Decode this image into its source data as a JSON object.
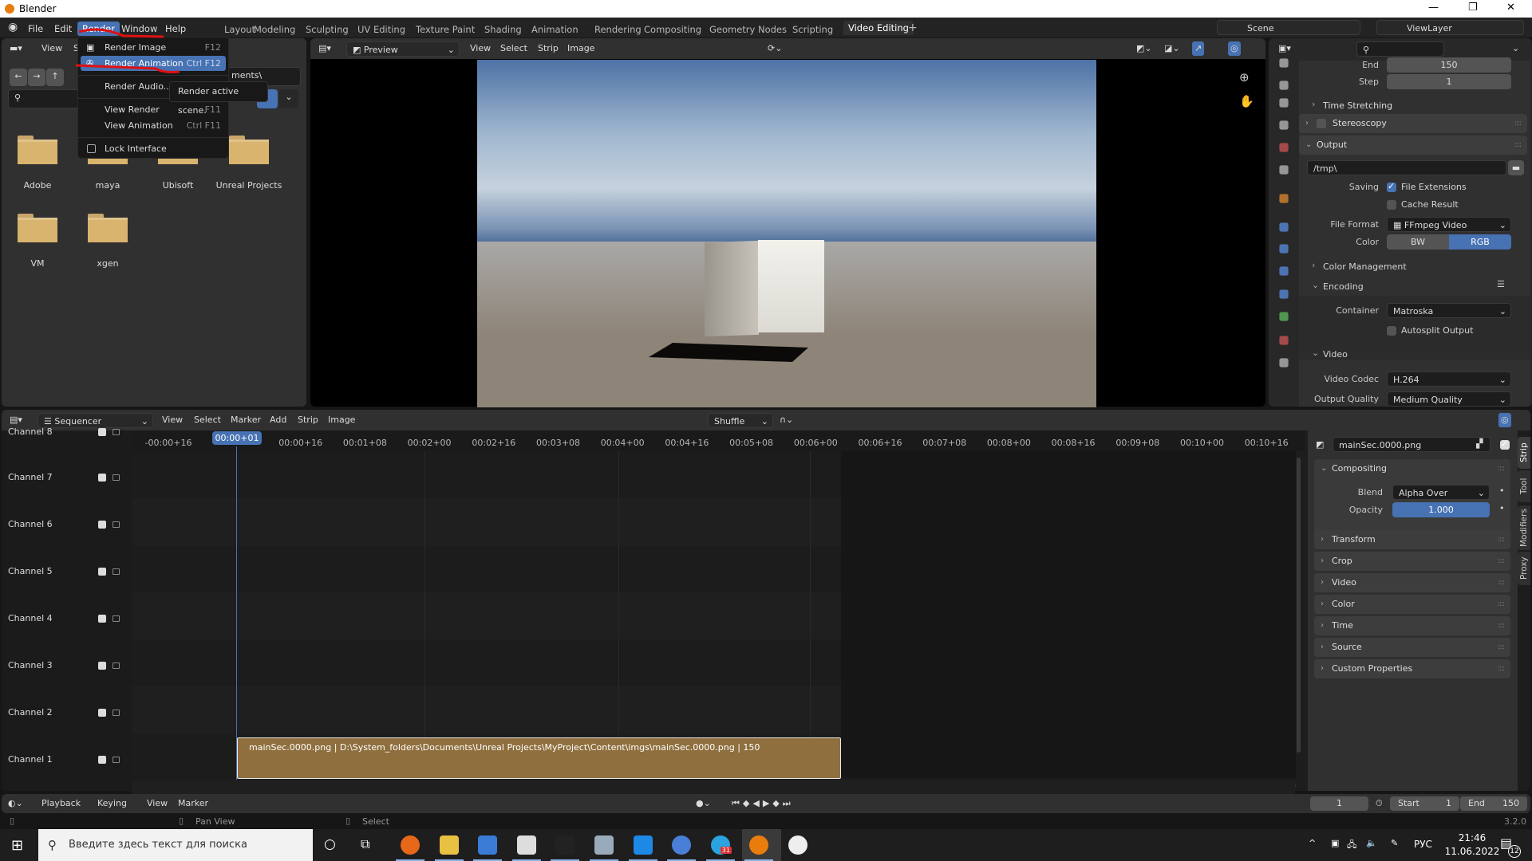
{
  "window": {
    "title": "Blender",
    "min": "—",
    "max": "❐",
    "close": "✕"
  },
  "menubar": {
    "items": [
      "File",
      "Edit",
      "Render",
      "Window",
      "Help"
    ],
    "active": "Render"
  },
  "workspaces": {
    "tabs": [
      "Layout",
      "Modeling",
      "Sculpting",
      "UV Editing",
      "Texture Paint",
      "Shading",
      "Animation",
      "Rendering",
      "Compositing",
      "Geometry Nodes",
      "Scripting",
      "Video Editing"
    ],
    "active": "Video Editing",
    "add": "+"
  },
  "scene": {
    "name": "Scene",
    "view_layer": "ViewLayer"
  },
  "render_menu": {
    "items": [
      {
        "label": "Render Image",
        "shortcut": "F12",
        "icon": "render-image-icon"
      },
      {
        "label": "Render Animation",
        "shortcut": "Ctrl F12",
        "icon": "render-animation-icon",
        "highlighted": true
      },
      {
        "label": "Render Audio...",
        "shortcut": ""
      },
      {
        "label": "View Render",
        "shortcut": "F11"
      },
      {
        "label": "View Animation",
        "shortcut": "Ctrl F11"
      },
      {
        "label": "Lock Interface",
        "shortcut": "",
        "checkbox": false
      }
    ],
    "tooltip": "Render active scene.",
    "annotation_color": "#e01010"
  },
  "file_browser": {
    "menu": [
      "View",
      "S"
    ],
    "path_tail": "ments\\",
    "folders": [
      "Adobe",
      "maya",
      "Ubisoft",
      "Unreal Projects",
      "VM",
      "xgen"
    ]
  },
  "preview": {
    "mode": "Preview",
    "menu": [
      "View",
      "Select",
      "Strip",
      "Image"
    ]
  },
  "properties": {
    "end_label": "End",
    "end": "150",
    "step_label": "Step",
    "step": "1",
    "time_stretching": "Time Stretching",
    "stereoscopy": "Stereoscopy",
    "output": "Output",
    "output_path": "/tmp\\",
    "saving_label": "Saving",
    "file_extensions": "File Extensions",
    "file_extensions_checked": true,
    "cache_result": "Cache Result",
    "cache_result_checked": false,
    "file_format_label": "File Format",
    "file_format": "FFmpeg Video",
    "color_label": "Color",
    "color_bw": "BW",
    "color_rgb": "RGB",
    "color_selected": "RGB",
    "color_management": "Color Management",
    "encoding": "Encoding",
    "container_label": "Container",
    "container": "Matroska",
    "autosplit": "Autosplit Output",
    "autosplit_checked": false,
    "video": "Video",
    "video_codec_label": "Video Codec",
    "video_codec": "H.264",
    "output_quality_label": "Output Quality",
    "output_quality": "Medium Quality"
  },
  "sequencer": {
    "editor": "Sequencer",
    "menu": [
      "View",
      "Select",
      "Marker",
      "Add",
      "Strip",
      "Image"
    ],
    "overlap_mode": "Shuffle",
    "current_time": "00:00+01",
    "ruler": [
      "-00:00+16",
      "00:00+01",
      "00:00+16",
      "00:01+08",
      "00:02+00",
      "00:02+16",
      "00:03+08",
      "00:04+00",
      "00:04+16",
      "00:05+08",
      "00:06+00",
      "00:06+16",
      "00:07+08",
      "00:08+00",
      "00:08+16",
      "00:09+08",
      "00:10+00",
      "00:10+16"
    ],
    "channels": [
      "Channel 8",
      "Channel 7",
      "Channel 6",
      "Channel 5",
      "Channel 4",
      "Channel 3",
      "Channel 2",
      "Channel 1"
    ],
    "strip": {
      "label": "mainSec.0000.png | D:\\System_folders\\Documents\\Unreal Projects\\MyProject\\Content\\imgs\\mainSec.0000.png | 150",
      "color": "#8f6f3e"
    }
  },
  "strip_sidebar": {
    "name": "mainSec.0000.png",
    "compositing": "Compositing",
    "blend_label": "Blend",
    "blend": "Alpha Over",
    "opacity_label": "Opacity",
    "opacity": "1.000",
    "panels": [
      "Transform",
      "Crop",
      "Video",
      "Color",
      "Time",
      "Source",
      "Custom Properties"
    ],
    "tabs": [
      "Strip",
      "Tool",
      "Modifiers",
      "Proxy"
    ],
    "active_tab": "Strip"
  },
  "timeline": {
    "menu": [
      "Playback",
      "Keying",
      "View",
      "Marker"
    ],
    "current_frame": "1",
    "start_label": "Start",
    "start": "1",
    "end_label": "End",
    "end": "150"
  },
  "statusbar": {
    "pan": "Pan View",
    "select": "Select",
    "version": "3.2.0"
  },
  "taskbar": {
    "search_placeholder": "Введите здесь текст для поиска",
    "lang": "РУС",
    "time": "21:46",
    "date": "11.06.2022",
    "notifications": "12",
    "telegram_badge": "31",
    "apps": [
      "firefox",
      "file-explorer",
      "microsoft-store",
      "mail",
      "epic-games",
      "task-manager",
      "virtualbox",
      "qbittorrent",
      "telegram",
      "blender",
      "steam"
    ]
  },
  "colors": {
    "accent": "#4772b3",
    "panel": "#303030",
    "strip": "#8f6f3e"
  }
}
